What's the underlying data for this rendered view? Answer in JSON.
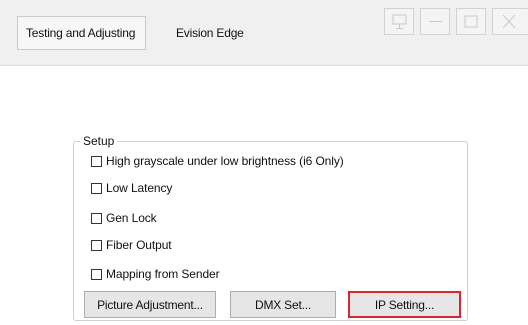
{
  "tabs": [
    {
      "label": "Testing and Adjusting",
      "active": true
    },
    {
      "label": "Evision Edge",
      "active": false
    }
  ],
  "window_controls": {
    "icons": [
      "monitor-icon",
      "minimize-icon",
      "maximize-icon",
      "close-icon"
    ]
  },
  "setup": {
    "title": "Setup",
    "options": [
      {
        "label": "High grayscale under  low brightness (i6 Only)",
        "checked": false
      },
      {
        "label": "Low Latency",
        "checked": false
      },
      {
        "label": "Gen Lock",
        "checked": false
      },
      {
        "label": "Fiber Output",
        "checked": false
      },
      {
        "label": "Mapping from Sender",
        "checked": false
      }
    ],
    "buttons": {
      "picture_adjustment": "Picture Adjustment...",
      "dmx_set": "DMX Set...",
      "ip_setting": "IP Setting..."
    }
  },
  "colors": {
    "highlight": "#d9272e"
  }
}
